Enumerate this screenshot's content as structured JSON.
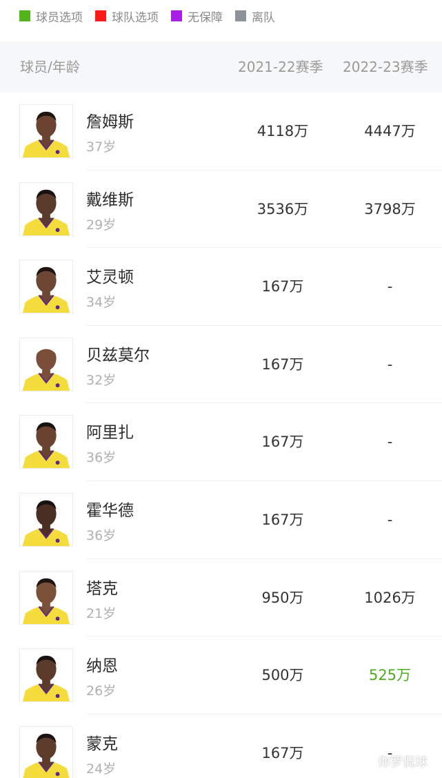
{
  "legend": [
    {
      "label": "球员选项",
      "color": "#52b31a"
    },
    {
      "label": "球队选项",
      "color": "#ff1a1a"
    },
    {
      "label": "无保障",
      "color": "#a81ee6"
    },
    {
      "label": "离队",
      "color": "#8e929a"
    }
  ],
  "header": {
    "player": "球员/年龄",
    "season1": "2021-22赛季",
    "season2": "2022-23赛季"
  },
  "players": [
    {
      "name": "詹姆斯",
      "age": "37岁",
      "s1": "4118万",
      "s2": "4447万",
      "s2_color": "#333333",
      "skin": "#6b4330",
      "hair": "#1e1410"
    },
    {
      "name": "戴维斯",
      "age": "29岁",
      "s1": "3536万",
      "s2": "3798万",
      "s2_color": "#333333",
      "skin": "#5a3a2a",
      "hair": "#1a1210"
    },
    {
      "name": "艾灵顿",
      "age": "34岁",
      "s1": "167万",
      "s2": "-",
      "s2_color": "#333333",
      "skin": "#6e4634",
      "hair": "#1e1410"
    },
    {
      "name": "贝兹莫尔",
      "age": "32岁",
      "s1": "167万",
      "s2": "-",
      "s2_color": "#333333",
      "skin": "#7a4e38",
      "hair": "#ffffff"
    },
    {
      "name": "阿里扎",
      "age": "36岁",
      "s1": "167万",
      "s2": "-",
      "s2_color": "#333333",
      "skin": "#6a4230",
      "hair": "#1a1210"
    },
    {
      "name": "霍华德",
      "age": "36岁",
      "s1": "167万",
      "s2": "-",
      "s2_color": "#333333",
      "skin": "#4a2e22",
      "hair": "#1a1210"
    },
    {
      "name": "塔克",
      "age": "21岁",
      "s1": "950万",
      "s2": "1026万",
      "s2_color": "#333333",
      "skin": "#7a5038",
      "hair": "#1e1410"
    },
    {
      "name": "纳恩",
      "age": "26岁",
      "s1": "500万",
      "s2": "525万",
      "s2_color": "#4cad1c",
      "skin": "#5c3a2a",
      "hair": "#1a1210"
    },
    {
      "name": "蒙克",
      "age": "24岁",
      "s1": "167万",
      "s2": "-",
      "s2_color": "#333333",
      "skin": "#5e3c2c",
      "hair": "#1a1210"
    }
  ],
  "watermark": "你罗侃球"
}
